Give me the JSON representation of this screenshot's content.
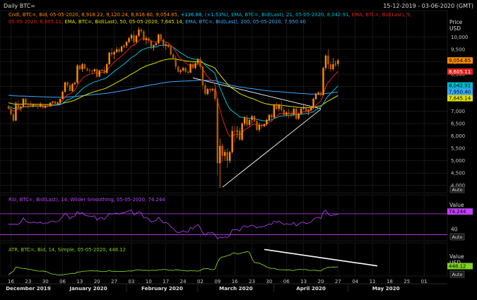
{
  "header": {
    "title": "Daily BTC=",
    "date_range": "15-12-2019 - 03-06-2020 (GMT)"
  },
  "legend": {
    "line1": [
      {
        "text": "Cndl, BTC=, Bid, 05-05-2020, 8,918.22, 9,120.24, 8,816.60, 9,054.65, ",
        "color": "#ff8c00"
      },
      {
        "text": "+136.88, (+1.53%), ",
        "color": "#00c8ff"
      },
      {
        "text": "EMA, BTC=, Bid(Last), 21, 05-05-2020, 8,042.91, ",
        "color": "#00bcd4"
      },
      {
        "text": "EMA, BTC=, Bid(Last), 9,",
        "color": "#e0201a"
      }
    ],
    "line2": [
      {
        "text": "05-05-2020, 8,605.11, ",
        "color": "#e0201a"
      },
      {
        "text": "EMA, BTC=, Bid(Last), 50, 05-05-2020, 7,645.14, ",
        "color": "#e0e000"
      },
      {
        "text": "EMA, BTC=, Bid(Last), 200, 05-05-2020, 7,950.40",
        "color": "#39a9ff"
      }
    ]
  },
  "price_axis": {
    "label1": "Price",
    "label2": "USD",
    "ticks": [
      "10,000",
      "9,500",
      "9,000",
      "8,500",
      "8,000",
      "7,500",
      "7,000",
      "6,500",
      "6,000",
      "5,500",
      "5,000",
      "4,500",
      "4,000"
    ],
    "tick_values": [
      10000,
      9500,
      9000,
      8500,
      8000,
      7500,
      7000,
      6500,
      6000,
      5500,
      5000,
      4500,
      4000
    ],
    "ylim": [
      3850,
      10300
    ],
    "auto": "Auto"
  },
  "price_badges": [
    {
      "value": 9054.65,
      "label": "9,054.65",
      "bg": "#ff8c00",
      "fg": "#000000"
    },
    {
      "value": 8605.11,
      "label": "8,605.11",
      "bg": "#e0201a",
      "fg": "#ffffff"
    },
    {
      "value": 8042.91,
      "label": "8,042.91",
      "bg": "#00bcd4",
      "fg": "#000000"
    },
    {
      "value": 7950.4,
      "label": "7,950.40",
      "bg": "#39a9ff",
      "fg": "#000000"
    },
    {
      "value": 7645.14,
      "label": "7,645.14",
      "bg": "#e0e000",
      "fg": "#000000"
    }
  ],
  "rsi": {
    "legend": "RSI, BTC=, Bid(Last), 14, Wilder Smoothing, 05-05-2020, 74.244",
    "color": "#c040ff",
    "axis_label": "Value",
    "tick": "40",
    "tick_value": 40,
    "ylim": [
      20,
      90
    ],
    "upper_level": 70,
    "lower_level": 30,
    "badge": "74.244",
    "badge_value": 74.244,
    "auto": "Auto"
  },
  "atr": {
    "legend": "ATR, BTC=, Bid, 14, Simple, 05-05-2020, 448.12",
    "color": "#7fd020",
    "axis_label1": "Value",
    "axis_label2": "USD",
    "badge": "448.12",
    "badge_value": 448.12,
    "ylim": [
      160,
      1000
    ],
    "auto": "Auto"
  },
  "time_axis": {
    "day_ticks": [
      "16",
      "23",
      "30",
      "06",
      "13",
      "20",
      "27",
      "03",
      "10",
      "17",
      "24",
      "02",
      "09",
      "16",
      "23",
      "30",
      "06",
      "13",
      "20",
      "27",
      "04",
      "11",
      "18",
      "25",
      "01"
    ],
    "months": [
      "December 2019",
      "January 2020",
      "February 2020",
      "March 2020",
      "April 2020",
      "May 2020"
    ]
  },
  "colors": {
    "background": "#000000",
    "grid": "#2e2e2e",
    "up_candle": "#ff8c00",
    "down_candle": "#b85a00",
    "trendline": "#ffffff",
    "axis_text": "#c8c8c8"
  },
  "chart_data": {
    "type": "candlestick",
    "start_date": "2019-12-15",
    "candles": [
      [
        7200,
        7260,
        7080,
        7100
      ],
      [
        7100,
        7120,
        6830,
        6880
      ],
      [
        6880,
        6950,
        6550,
        6620
      ],
      [
        6620,
        7400,
        6600,
        7280
      ],
      [
        7280,
        7450,
        7080,
        7150
      ],
      [
        7150,
        7220,
        7000,
        7190
      ],
      [
        7190,
        7530,
        7150,
        7500
      ],
      [
        7500,
        7540,
        7250,
        7320
      ],
      [
        7320,
        7340,
        7100,
        7250
      ],
      [
        7250,
        7420,
        7180,
        7200
      ],
      [
        7200,
        7300,
        7150,
        7260
      ],
      [
        7260,
        7300,
        7200,
        7230
      ],
      [
        7230,
        7280,
        7100,
        7190
      ],
      [
        7190,
        7370,
        7150,
        7290
      ],
      [
        7290,
        7310,
        7100,
        7140
      ],
      [
        7140,
        7250,
        7120,
        7220
      ],
      [
        7220,
        7260,
        7150,
        7200
      ],
      [
        7200,
        7360,
        7180,
        7350
      ],
      [
        7350,
        7420,
        7320,
        7390
      ],
      [
        7390,
        7420,
        7280,
        7320
      ],
      [
        7320,
        7400,
        7250,
        7350
      ],
      [
        7350,
        7520,
        7300,
        7500
      ],
      [
        7500,
        7820,
        7480,
        7790
      ],
      [
        7790,
        8200,
        7750,
        8170
      ],
      [
        8170,
        8200,
        7950,
        8050
      ],
      [
        8050,
        8160,
        7900,
        7820
      ],
      [
        7820,
        8150,
        7800,
        8100
      ],
      [
        8100,
        8200,
        8050,
        8150
      ],
      [
        8150,
        8900,
        8100,
        8850
      ],
      [
        8850,
        8880,
        8650,
        8700
      ],
      [
        8700,
        8950,
        8600,
        8900
      ],
      [
        8900,
        8950,
        8700,
        8720
      ],
      [
        8720,
        8780,
        8600,
        8660
      ],
      [
        8660,
        8750,
        8550,
        8640
      ],
      [
        8640,
        8690,
        8500,
        8620
      ],
      [
        8620,
        8720,
        8580,
        8700
      ],
      [
        8700,
        8730,
        8350,
        8400
      ],
      [
        8400,
        8680,
        8380,
        8650
      ],
      [
        8650,
        8700,
        8600,
        8670
      ],
      [
        8670,
        8800,
        8500,
        8550
      ],
      [
        8550,
        8950,
        8520,
        8900
      ],
      [
        8900,
        9400,
        8880,
        9370
      ],
      [
        9370,
        9550,
        9200,
        9300
      ],
      [
        9300,
        9450,
        9100,
        9400
      ],
      [
        9400,
        9600,
        9350,
        9500
      ],
      [
        9500,
        9580,
        9350,
        9420
      ],
      [
        9420,
        9650,
        9380,
        9620
      ],
      [
        9620,
        9700,
        9550,
        9650
      ],
      [
        9650,
        9850,
        9550,
        9800
      ],
      [
        9800,
        10000,
        9750,
        9950
      ],
      [
        9950,
        10150,
        9850,
        10080
      ],
      [
        10080,
        10250,
        9700,
        9800
      ],
      [
        9800,
        10100,
        9750,
        10050
      ],
      [
        10050,
        10400,
        10000,
        10300
      ],
      [
        10300,
        10350,
        10150,
        10230
      ],
      [
        10230,
        10300,
        9850,
        9880
      ],
      [
        9880,
        10050,
        9700,
        9950
      ],
      [
        9950,
        10000,
        9750,
        9850
      ],
      [
        9850,
        9900,
        9500,
        9600
      ],
      [
        9600,
        9700,
        9450,
        9680
      ],
      [
        9680,
        9800,
        9650,
        9750
      ],
      [
        9750,
        10150,
        9700,
        10100
      ],
      [
        10100,
        10150,
        9850,
        9900
      ],
      [
        9900,
        9950,
        9550,
        9650
      ],
      [
        9650,
        9800,
        9500,
        9700
      ],
      [
        9700,
        9750,
        9550,
        9600
      ],
      [
        9600,
        9650,
        9250,
        9300
      ],
      [
        9300,
        9350,
        9100,
        9150
      ],
      [
        9150,
        9250,
        8700,
        8800
      ],
      [
        8800,
        8850,
        8550,
        8600
      ],
      [
        8600,
        8700,
        8500,
        8650
      ],
      [
        8650,
        8800,
        8600,
        8750
      ],
      [
        8750,
        8800,
        8550,
        8600
      ],
      [
        8600,
        8650,
        8500,
        8560
      ],
      [
        8560,
        8950,
        8550,
        8900
      ],
      [
        8900,
        9000,
        8700,
        8750
      ],
      [
        8750,
        8980,
        8700,
        8950
      ],
      [
        8950,
        9150,
        8850,
        9100
      ],
      [
        9100,
        9200,
        8700,
        8800
      ],
      [
        8800,
        8850,
        7900,
        8050
      ],
      [
        8050,
        8150,
        7650,
        7700
      ],
      [
        7700,
        7950,
        7650,
        7900
      ],
      [
        7900,
        7950,
        7750,
        7850
      ],
      [
        7850,
        7950,
        7800,
        7900
      ],
      [
        7900,
        7950,
        7400,
        7500
      ],
      [
        7500,
        7550,
        4400,
        4900
      ],
      [
        4900,
        5900,
        3900,
        5600
      ],
      [
        5600,
        5700,
        4950,
        5200
      ],
      [
        5200,
        5450,
        5000,
        5350
      ],
      [
        5350,
        5500,
        4700,
        5000
      ],
      [
        5000,
        5400,
        4900,
        5350
      ],
      [
        5350,
        6400,
        5300,
        6200
      ],
      [
        6200,
        6400,
        5750,
        6180
      ],
      [
        6180,
        6400,
        5900,
        6220
      ],
      [
        6220,
        6350,
        5800,
        5850
      ],
      [
        5850,
        6550,
        5800,
        6500
      ],
      [
        6500,
        6800,
        6400,
        6750
      ],
      [
        6750,
        6850,
        6350,
        6450
      ],
      [
        6450,
        6700,
        6400,
        6650
      ],
      [
        6650,
        6850,
        6500,
        6800
      ],
      [
        6800,
        6850,
        6550,
        6600
      ],
      [
        6600,
        6700,
        6200,
        6250
      ],
      [
        6250,
        6550,
        6150,
        6450
      ],
      [
        6450,
        6500,
        6300,
        6400
      ],
      [
        6400,
        6500,
        6350,
        6480
      ],
      [
        6480,
        6700,
        6400,
        6650
      ],
      [
        6650,
        6900,
        6600,
        6850
      ],
      [
        6850,
        6900,
        6650,
        6750
      ],
      [
        6750,
        7300,
        6700,
        7250
      ],
      [
        7300,
        7350,
        7050,
        7100
      ],
      [
        7100,
        7300,
        7000,
        7250
      ],
      [
        7250,
        7400,
        7000,
        7050
      ],
      [
        7050,
        7150,
        6800,
        6850
      ],
      [
        6850,
        7000,
        6800,
        6950
      ],
      [
        6950,
        7100,
        6700,
        6900
      ],
      [
        6900,
        7000,
        6750,
        6850
      ],
      [
        6850,
        7150,
        6800,
        7100
      ],
      [
        7100,
        7150,
        6650,
        6700
      ],
      [
        6700,
        6950,
        6650,
        6900
      ],
      [
        6900,
        7150,
        6850,
        7100
      ],
      [
        7100,
        7300,
        7050,
        7150
      ],
      [
        7150,
        7250,
        6950,
        7000
      ],
      [
        7000,
        7100,
        6850,
        7050
      ],
      [
        7050,
        7200,
        7000,
        7150
      ],
      [
        7150,
        7550,
        7100,
        7500
      ],
      [
        7500,
        7750,
        7450,
        7700
      ],
      [
        7700,
        7800,
        7650,
        7750
      ],
      [
        7750,
        7800,
        7600,
        7650
      ],
      [
        7650,
        8800,
        7650,
        8750
      ],
      [
        8750,
        9300,
        8650,
        9250
      ],
      [
        9250,
        9500,
        8700,
        8900
      ],
      [
        8900,
        9000,
        8600,
        8700
      ],
      [
        8700,
        9150,
        8650,
        8900
      ],
      [
        8900,
        9050,
        8800,
        8917
      ],
      [
        8918.22,
        9120.24,
        8816.6,
        9054.65
      ]
    ],
    "ema9_end": 8605.11,
    "ema21_end": 8042.91,
    "ema50_end": 7645.14,
    "ema200_end": 7950.4,
    "rsi_last": 74.244,
    "atr_last": 448.12
  }
}
